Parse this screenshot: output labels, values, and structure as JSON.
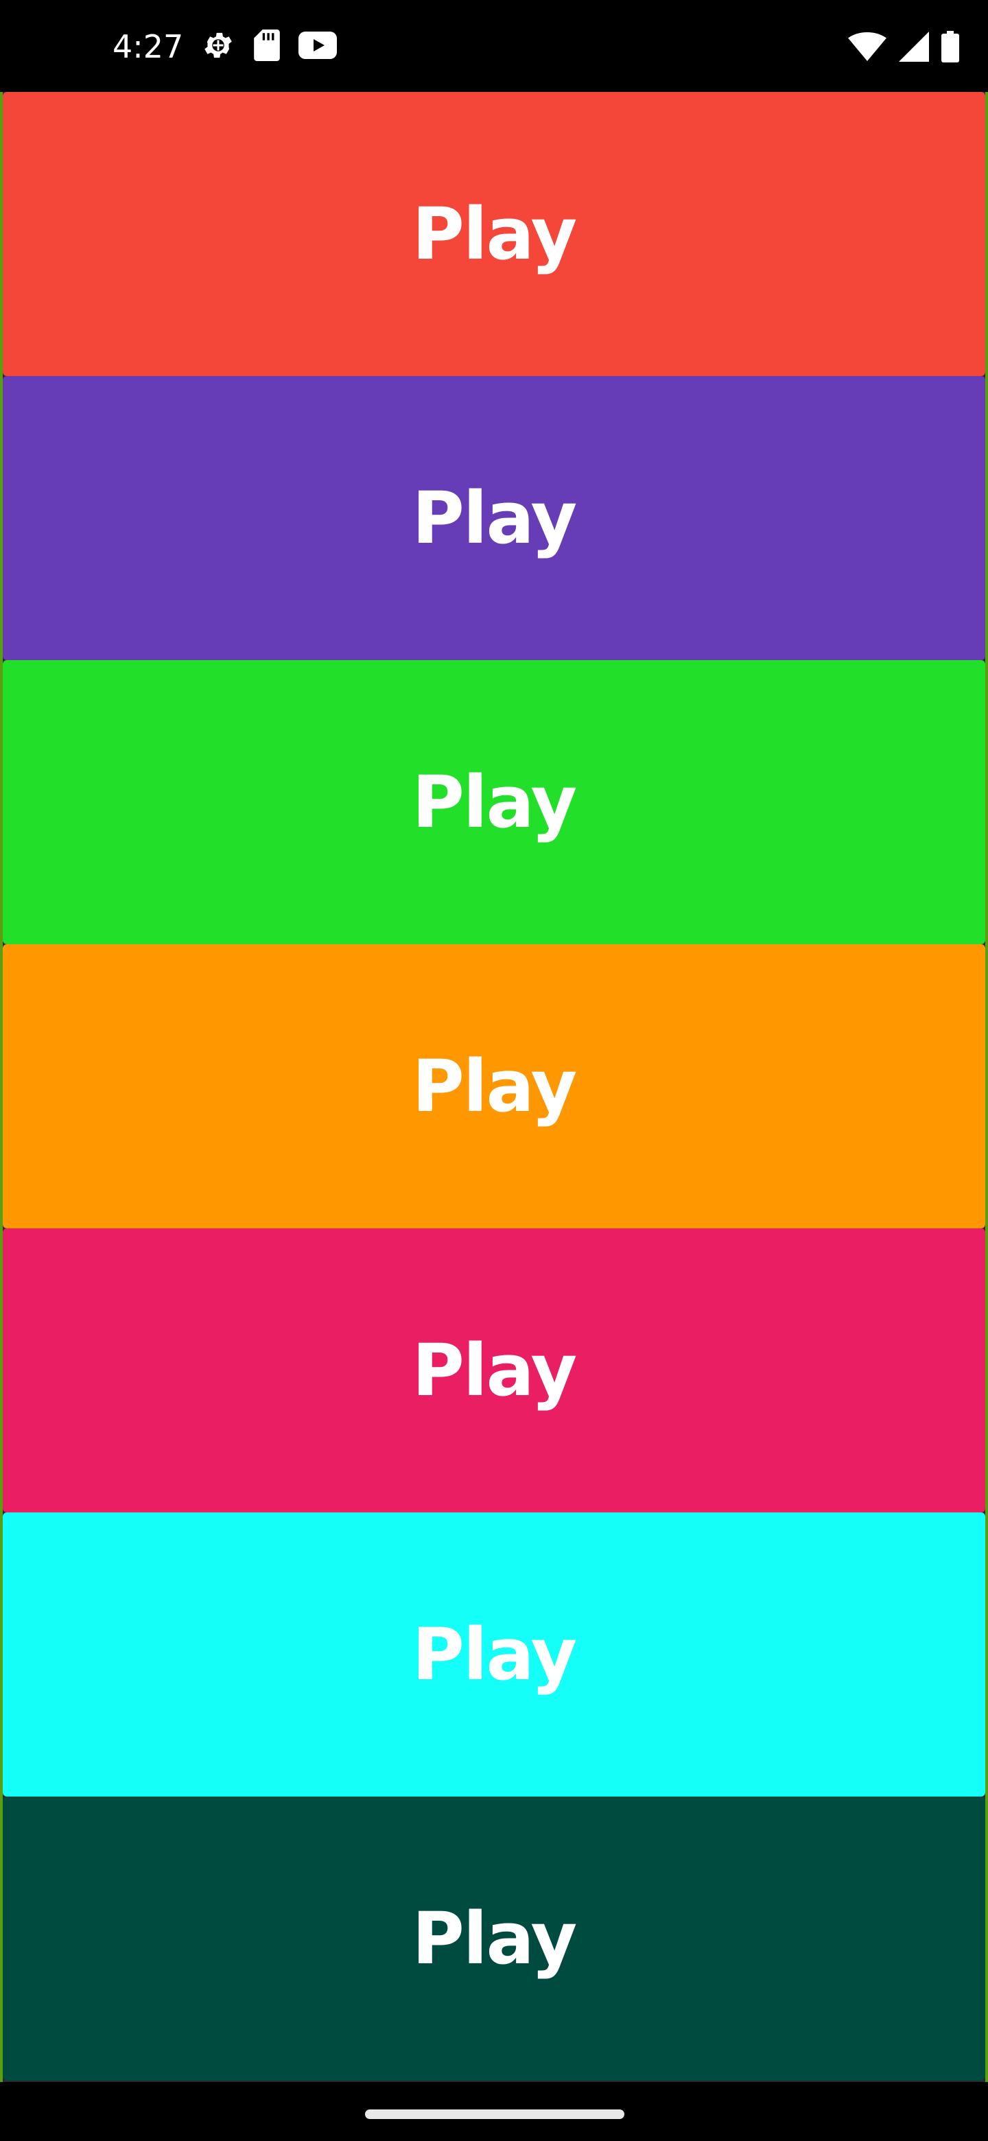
{
  "status_bar": {
    "time": "4:27",
    "left_icons": [
      "settings-gear-icon",
      "sd-card-icon",
      "youtube-icon"
    ],
    "right_icons": [
      "wifi-icon",
      "cell-signal-icon",
      "battery-icon"
    ]
  },
  "buttons": [
    {
      "label": "Play",
      "color": "#F4473A"
    },
    {
      "label": "Play",
      "color": "#673DB7"
    },
    {
      "label": "Play",
      "color": "#22E02A"
    },
    {
      "label": "Play",
      "color": "#FF9700"
    },
    {
      "label": "Play",
      "color": "#E91E63"
    },
    {
      "label": "Play",
      "color": "#13FFF8"
    },
    {
      "label": "Play",
      "color": "#004B40"
    }
  ]
}
